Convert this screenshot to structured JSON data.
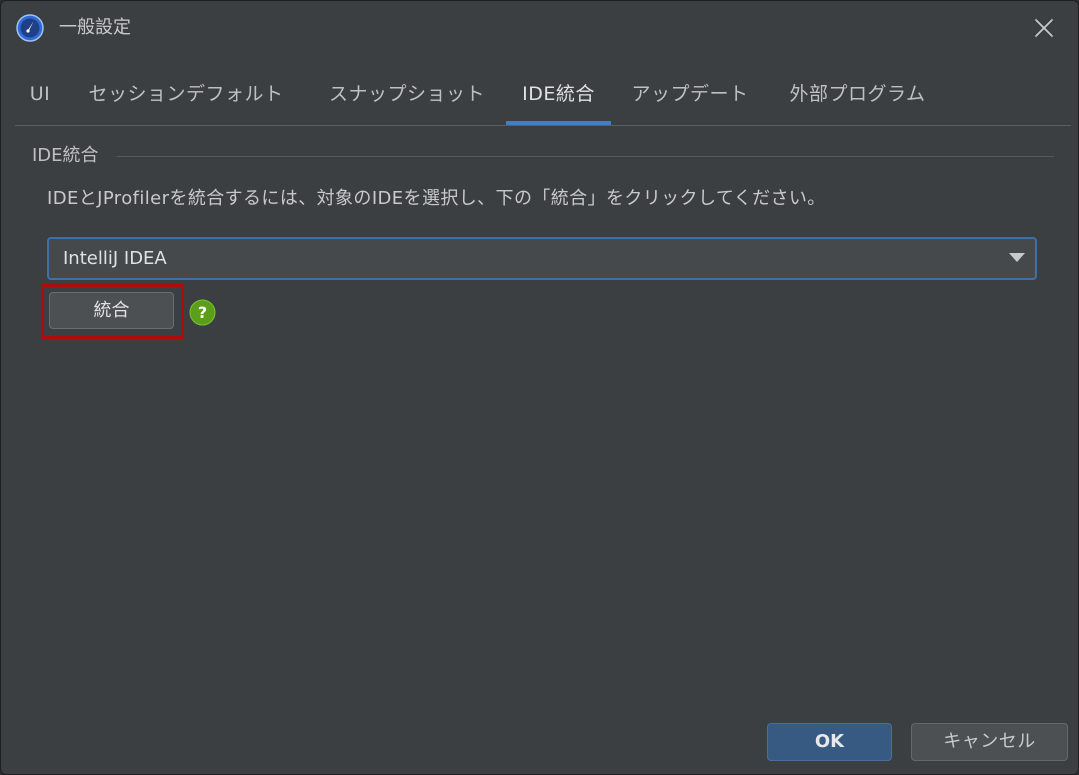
{
  "window": {
    "title": "一般設定",
    "app_icon": "gauge-icon",
    "close_icon": "close-icon"
  },
  "tabs": [
    {
      "label": "UI",
      "active": false
    },
    {
      "label": "セッションデフォルト",
      "active": false
    },
    {
      "label": "スナップショット",
      "active": false
    },
    {
      "label": "IDE統合",
      "active": true
    },
    {
      "label": "アップデート",
      "active": false
    },
    {
      "label": "外部プログラム",
      "active": false
    }
  ],
  "ide_group": {
    "title": "IDE統合",
    "description": "IDEとJProfilerを統合するには、対象のIDEを選択し、下の「統合」をクリックしてください。",
    "selected_ide": "IntelliJ IDEA",
    "integrate_label": "統合",
    "help_icon": "help-icon"
  },
  "footer": {
    "ok_label": "OK",
    "cancel_label": "キャンセル"
  },
  "colors": {
    "accent": "#3d7fc9",
    "highlight": "#b00a0a",
    "help_green": "#5a9e1a"
  }
}
